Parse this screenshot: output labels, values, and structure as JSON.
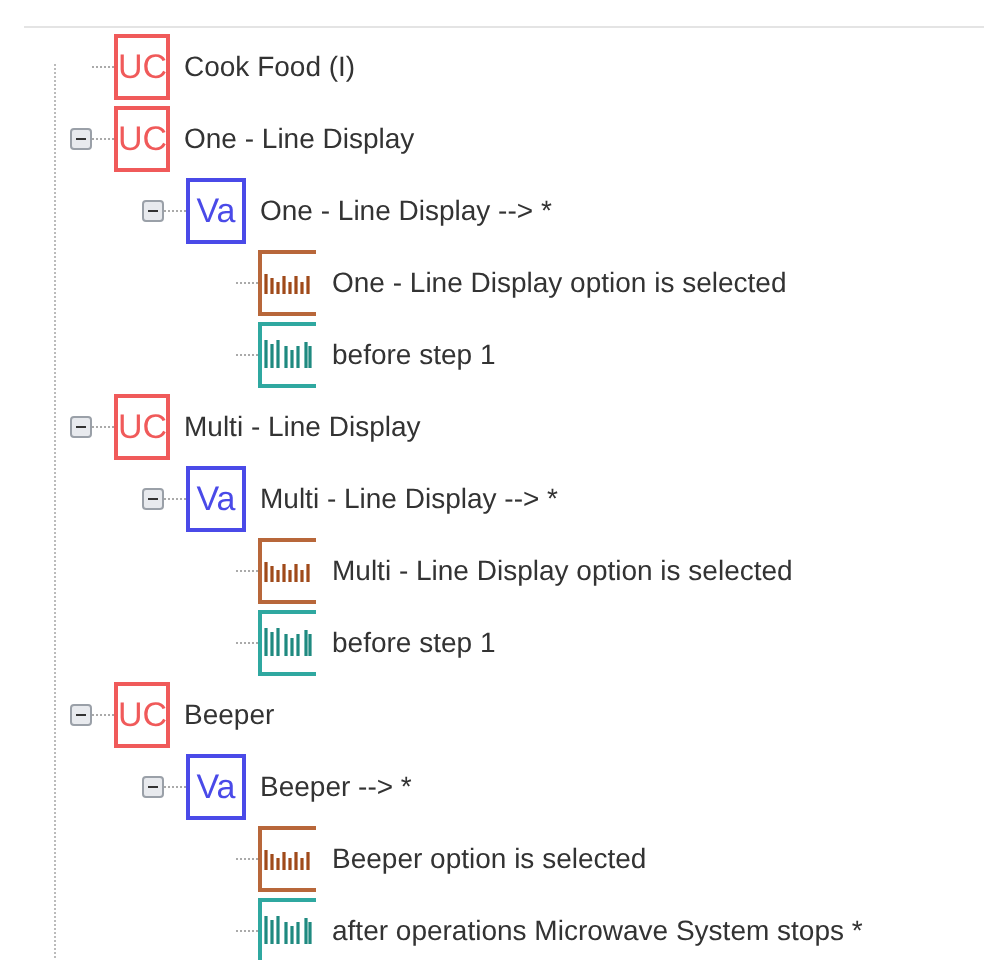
{
  "tree": [
    {
      "kind": "uc",
      "badge": "UC",
      "label": "Cook Food (I)"
    },
    {
      "kind": "uc",
      "badge": "UC",
      "label": "One - Line Display",
      "expanded": true,
      "children": [
        {
          "kind": "va",
          "badge": "Va",
          "label": "One - Line Display --> *",
          "expanded": true,
          "children": [
            {
              "kind": "cond",
              "label": "One - Line Display option is selected"
            },
            {
              "kind": "post",
              "label": "before step 1"
            }
          ]
        }
      ]
    },
    {
      "kind": "uc",
      "badge": "UC",
      "label": "Multi - Line Display",
      "expanded": true,
      "children": [
        {
          "kind": "va",
          "badge": "Va",
          "label": "Multi - Line Display --> *",
          "expanded": true,
          "children": [
            {
              "kind": "cond",
              "label": "Multi - Line Display option is selected"
            },
            {
              "kind": "post",
              "label": "before step 1"
            }
          ]
        }
      ]
    },
    {
      "kind": "uc",
      "badge": "UC",
      "label": "Beeper",
      "expanded": true,
      "children": [
        {
          "kind": "va",
          "badge": "Va",
          "label": "Beeper --> *",
          "expanded": true,
          "children": [
            {
              "kind": "cond",
              "label": "Beeper option is selected"
            },
            {
              "kind": "post",
              "label": "after operations Microwave System stops *"
            }
          ]
        }
      ]
    }
  ]
}
